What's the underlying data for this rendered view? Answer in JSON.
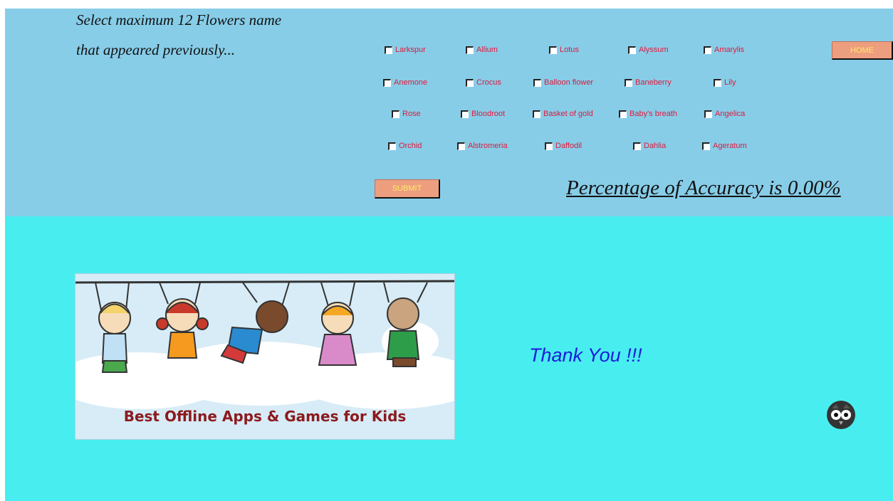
{
  "instructions": {
    "line1": "Select maximum 12 Flowers name",
    "line2": "that appeared previously..."
  },
  "flowers": [
    "Larkspur",
    "Allium",
    "Lotus",
    "Alyssum",
    "Amarylis",
    "Anemone",
    "Crocus",
    "Balloon flower",
    "Baneberry",
    "Lily",
    "Rose",
    "Bloodroot",
    "Basket of gold",
    "Baby's breath",
    "Angelica",
    "Orchid",
    "Alstromeria",
    "Daffodil",
    "Dahlia",
    "Ageratum"
  ],
  "buttons": {
    "home": "HOME",
    "submit": "SUBMIT"
  },
  "result": {
    "accuracy_text": "Percentage of Accuracy is 0.00%"
  },
  "banner": {
    "text": "Best Offline Apps & Games for Kids"
  },
  "message": {
    "thank_you": "Thank You !!!"
  },
  "icons": {
    "checkbox": "checkbox-icon",
    "owl": "owl-logo-icon"
  },
  "colors": {
    "top_panel": "#87cde8",
    "bottom_panel": "#48eeef",
    "button_fill": "#ed9e7e",
    "button_text": "#ffe96a",
    "label_text": "#e0193c",
    "thank_you": "#1c1cdc"
  }
}
